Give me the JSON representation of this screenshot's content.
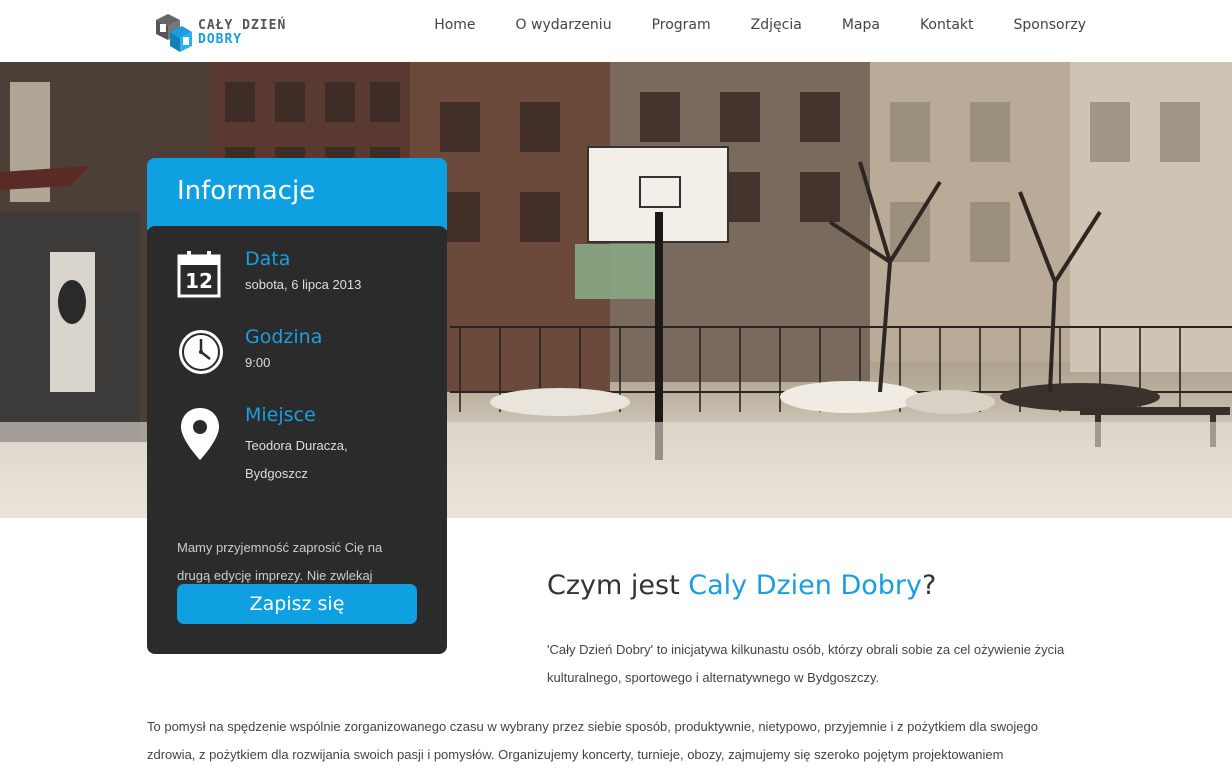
{
  "brand": {
    "line1": "CAŁY DZIEŃ",
    "line2": "DOBRY"
  },
  "nav": {
    "items": [
      {
        "label": "Home"
      },
      {
        "label": "O wydarzeniu"
      },
      {
        "label": "Program"
      },
      {
        "label": "Zdjęcia"
      },
      {
        "label": "Mapa"
      },
      {
        "label": "Kontakt"
      },
      {
        "label": "Sponsorzy"
      }
    ]
  },
  "hero": {
    "image": "basketball-court-photo"
  },
  "info": {
    "title": "Informacje",
    "date": {
      "label": "Data",
      "value": "sobota, 6 lipca 2013",
      "icon": "calendar-icon",
      "day": "12"
    },
    "time": {
      "label": "Godzina",
      "value": "9:00",
      "icon": "clock-icon"
    },
    "place": {
      "label": "Miejsce",
      "line1": "Teodora Duracza,",
      "line2": "Bydgoszcz",
      "icon": "map-pin-icon"
    },
    "note": "Mamy przyjemność zaprosić Cię na drugą edycję imprezy. Nie zwlekaj",
    "cta": "Zapisz się"
  },
  "content": {
    "title_prefix": "Czym jest ",
    "title_accent": "Caly Dzien Dobry",
    "title_suffix": "?",
    "intro": "'Cały Dzień Dobry' to inicjatywa kilkunastu osób, którzy obrali sobie za cel ożywienie życia kulturalnego, sportowego i alternatywnego w Bydgoszczy.",
    "body": "To pomysł na spędzenie wspólnie zorganizowanego czasu w wybrany przez siebie sposób, produktywnie, nietypowo, przyjemnie i z pożytkiem dla swojego zdrowia, z pożytkiem dla rozwijania swoich pasji i pomysłów. Organizujemy koncerty, turnieje, obozy, zajmujemy się szeroko pojętym projektowaniem"
  },
  "colors": {
    "accent": "#0ea0e0",
    "card_bg": "#2b2b2b",
    "text": "#444444"
  }
}
